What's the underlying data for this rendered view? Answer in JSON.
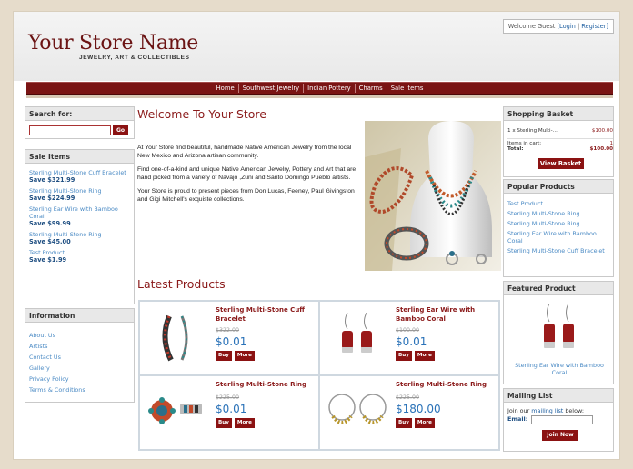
{
  "header": {
    "store_name": "Your Store Name",
    "tagline": "JEWELRY, ART & COLLECTIBLES",
    "welcome_text": "Welcome Guest",
    "login": "[Login",
    "register": "Register]"
  },
  "nav": [
    "Home",
    "Southwest Jewelry",
    "Indian Pottery",
    "Charms",
    "Sale Items"
  ],
  "search": {
    "title": "Search for:",
    "go": "Go"
  },
  "sale_items": {
    "title": "Sale Items",
    "items": [
      {
        "name": "Sterling Multi-Stone Cuff Bracelet",
        "save": "Save $321.99"
      },
      {
        "name": "Sterling Multi-Stone Ring",
        "save": "Save $224.99"
      },
      {
        "name": "Sterling Ear Wire with Bamboo Coral",
        "save": "Save $99.99"
      },
      {
        "name": "Sterling Multi-Stone Ring",
        "save": "Save $45.00"
      },
      {
        "name": "Test Product",
        "save": "Save $1.99"
      }
    ]
  },
  "information": {
    "title": "Information",
    "links": [
      "About Us",
      "Artists",
      "Contact Us",
      "Gallery",
      "Privacy Policy",
      "Terms & Conditions"
    ]
  },
  "main": {
    "title": "Welcome To Your Store",
    "paragraphs": [
      "At Your Store find beautiful, handmade Native American Jewelry from the local New Mexico and Arizona artisan community.",
      "Find one-of-a-kind and unique Native American Jewelry, Pottery and Art that are hand picked from a variety of Navajo ,Zuni and Santo Domingo Pueblo artists.",
      "Your Store is proud to present pieces from Don Lucas, Feeney, Paul Givingston and Gigi Mitchell's exquiste collections."
    ],
    "latest_title": "Latest Products"
  },
  "products": [
    {
      "name": "Sterling Multi-Stone Cuff Bracelet",
      "old_price": "$322.00",
      "price": "$0.01",
      "buy": "Buy",
      "more": "More"
    },
    {
      "name": "Sterling Ear Wire with Bamboo Coral",
      "old_price": "$100.00",
      "price": "$0.01",
      "buy": "Buy",
      "more": "More"
    },
    {
      "name": "Sterling Multi-Stone Ring",
      "old_price": "$225.00",
      "price": "$0.01",
      "buy": "Buy",
      "more": "More"
    },
    {
      "name": "Sterling Multi-Stone Ring",
      "old_price": "$225.00",
      "price": "$180.00",
      "buy": "Buy",
      "more": "More"
    }
  ],
  "basket": {
    "title": "Shopping Basket",
    "line_item": "1 x Sterling Multi-...",
    "line_price": "$100.00",
    "items_label": "Items in cart:",
    "items_count": "1",
    "total_label": "Total:",
    "total_value": "$100.00",
    "view_button": "View Basket"
  },
  "popular": {
    "title": "Popular Products",
    "links": [
      "Test Product",
      "Sterling Multi-Stone Ring",
      "Sterling Multi-Stone Ring",
      "Sterling Ear Wire with Bamboo Coral",
      "Sterling Multi-Stone Cuff Bracelet"
    ]
  },
  "featured": {
    "title": "Featured Product",
    "caption": "Sterling Ear Wire with Bamboo Coral"
  },
  "mailing": {
    "title": "Mailing List",
    "text_pre": "Join our ",
    "text_link": "mailing list",
    "text_post": " below:",
    "email_label": "Email:",
    "join": "Join Now"
  },
  "colors": {
    "brand": "#7a1414",
    "link": "#4a8ac4",
    "price": "#2a72b8"
  }
}
